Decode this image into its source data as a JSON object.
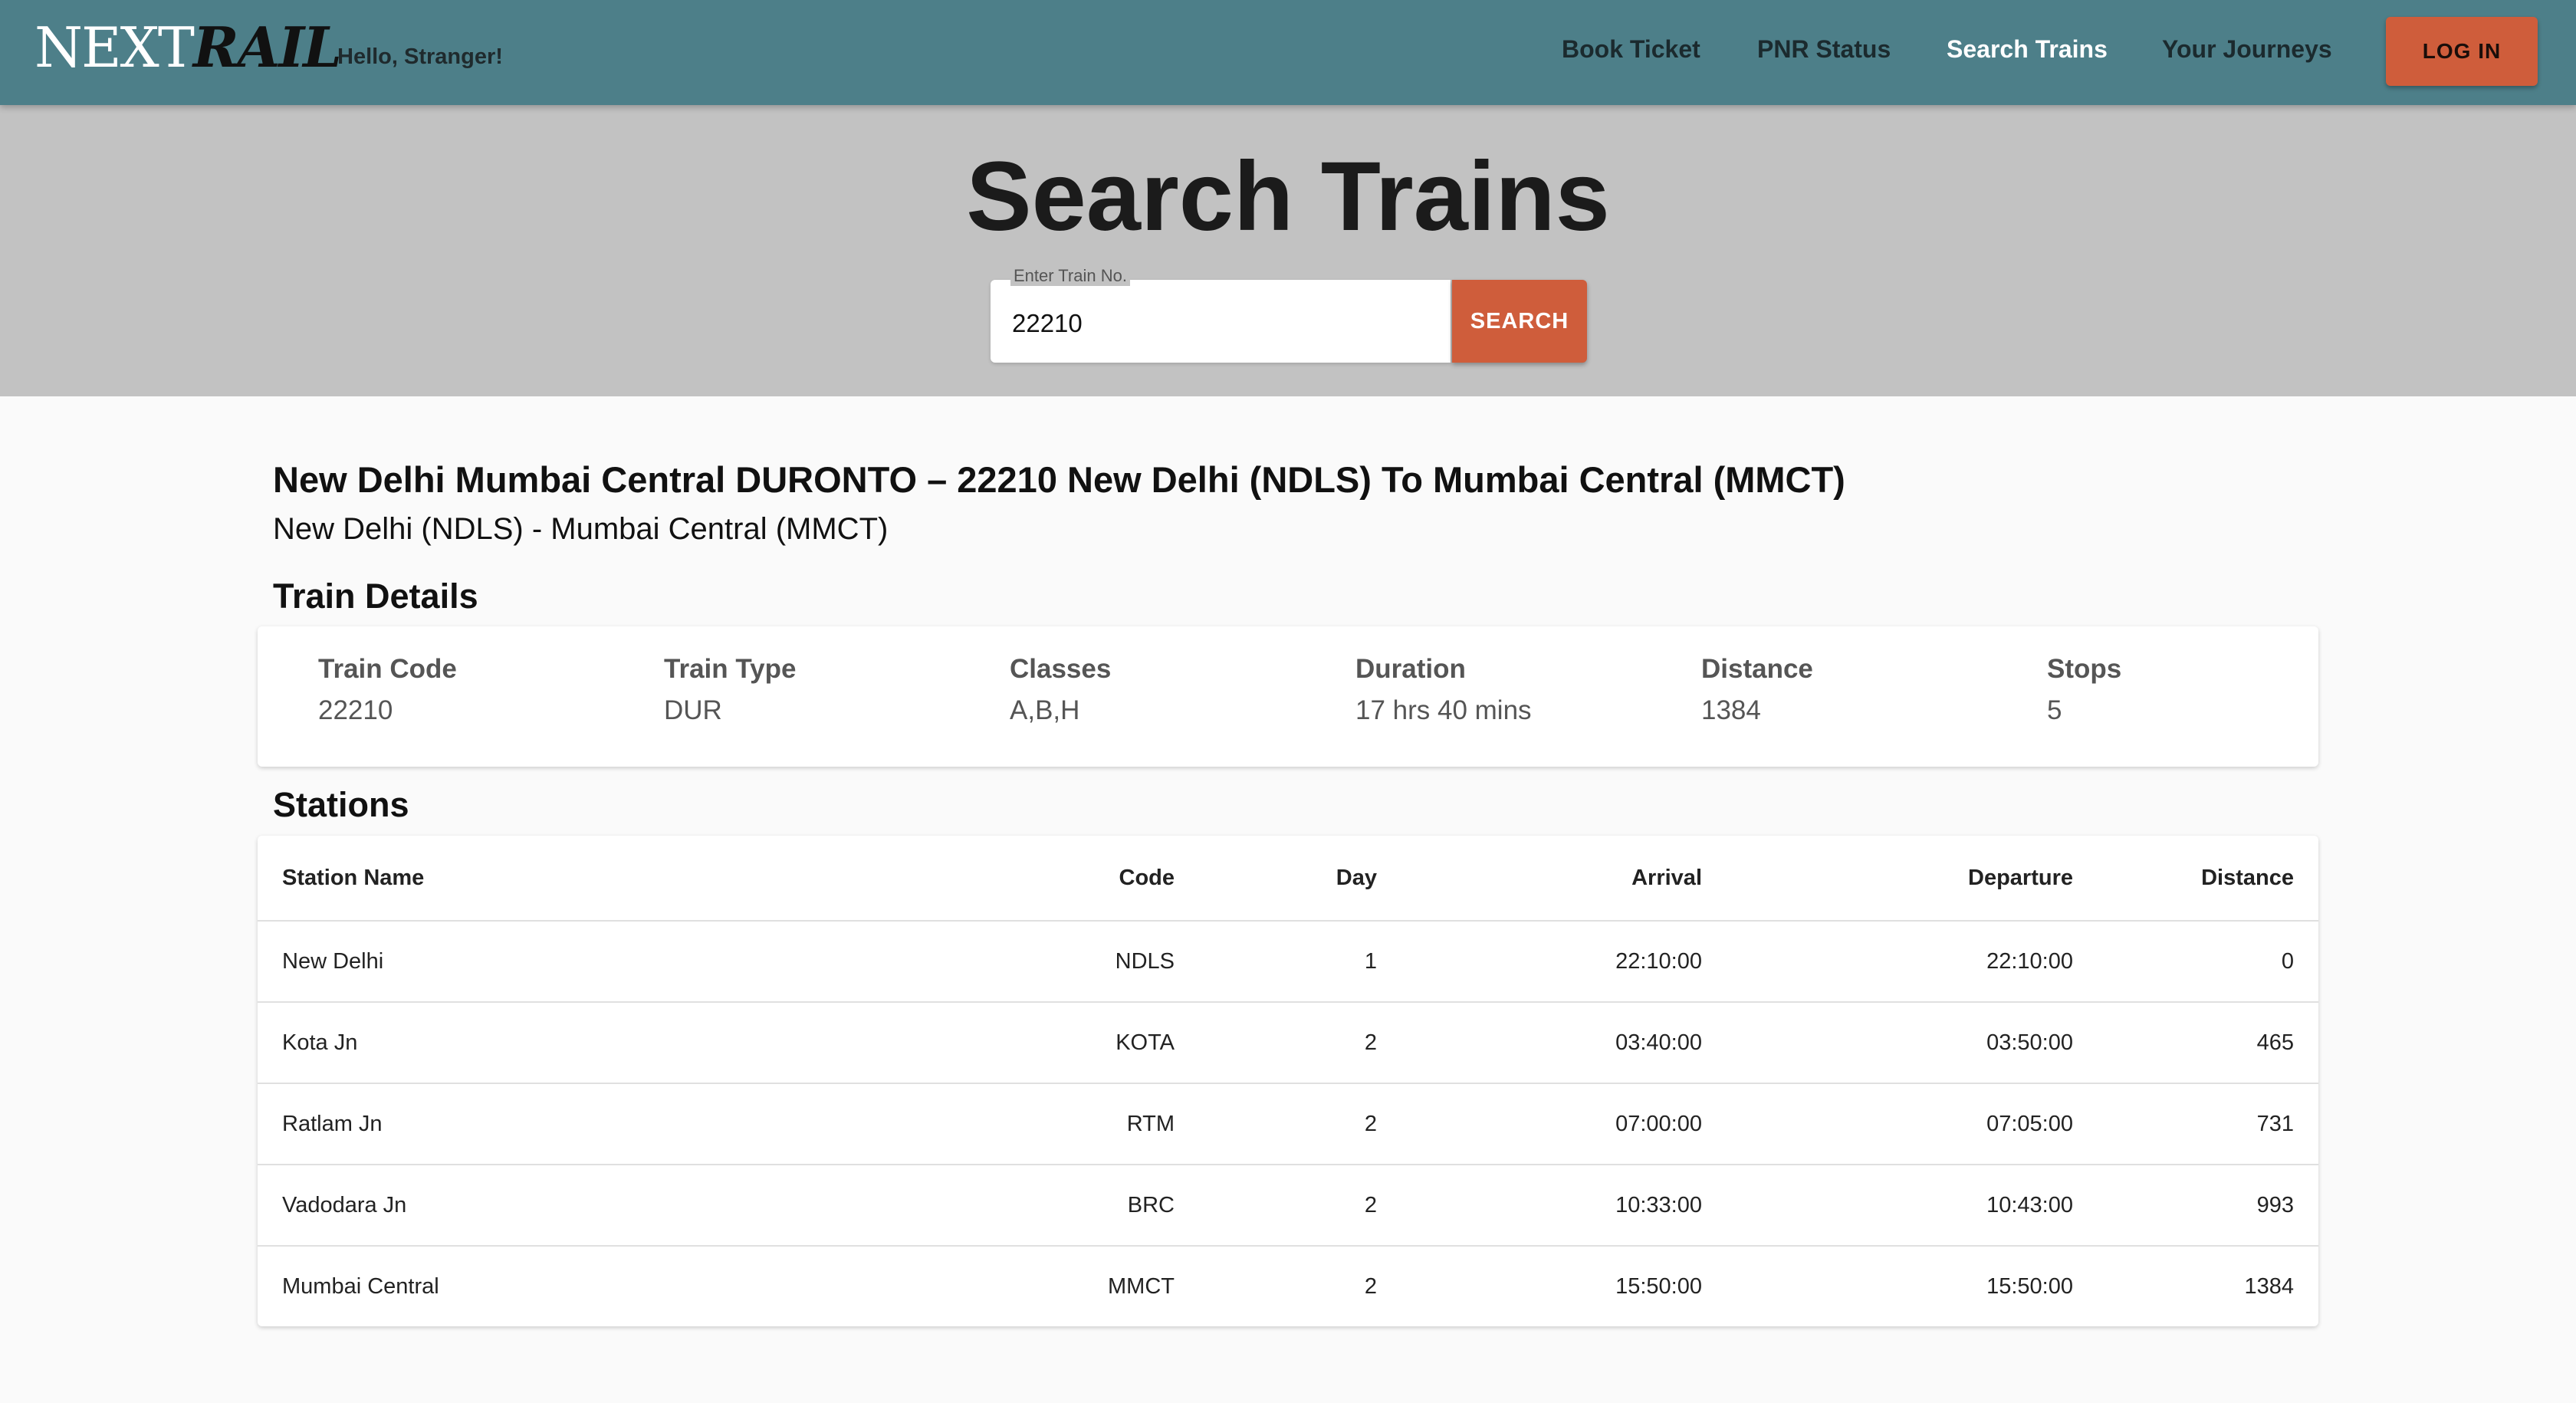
{
  "header": {
    "brand_next": "NEXT",
    "brand_rail": "RAIL",
    "greeting": "Hello, Stranger!",
    "nav": [
      "Book Ticket",
      "PNR Status",
      "Search Trains",
      "Your Journeys"
    ],
    "active_nav": "Search Trains",
    "login_label": "LOG IN"
  },
  "hero": {
    "title": "Search Trains",
    "search_label": "Enter Train No.",
    "search_value": "22210",
    "search_button": "SEARCH"
  },
  "train": {
    "title": "New Delhi Mumbai Central DURONTO – 22210 New Delhi (NDLS) To Mumbai Central (MMCT)",
    "route": "New Delhi (NDLS) - Mumbai Central (MMCT)"
  },
  "details": {
    "heading": "Train Details",
    "items": [
      {
        "label": "Train Code",
        "value": "22210"
      },
      {
        "label": "Train Type",
        "value": "DUR"
      },
      {
        "label": "Classes",
        "value": "A,B,H"
      },
      {
        "label": "Duration",
        "value": "17 hrs 40 mins"
      },
      {
        "label": "Distance",
        "value": "1384"
      },
      {
        "label": "Stops",
        "value": "5"
      }
    ]
  },
  "stations": {
    "heading": "Stations",
    "columns": [
      "Station Name",
      "Code",
      "Day",
      "Arrival",
      "Departure",
      "Distance"
    ],
    "rows": [
      [
        "New Delhi",
        "NDLS",
        "1",
        "22:10:00",
        "22:10:00",
        "0"
      ],
      [
        "Kota Jn",
        "KOTA",
        "2",
        "03:40:00",
        "03:50:00",
        "465"
      ],
      [
        "Ratlam Jn",
        "RTM",
        "2",
        "07:00:00",
        "07:05:00",
        "731"
      ],
      [
        "Vadodara Jn",
        "BRC",
        "2",
        "10:33:00",
        "10:43:00",
        "993"
      ],
      [
        "Mumbai Central",
        "MMCT",
        "2",
        "15:50:00",
        "15:50:00",
        "1384"
      ]
    ]
  }
}
